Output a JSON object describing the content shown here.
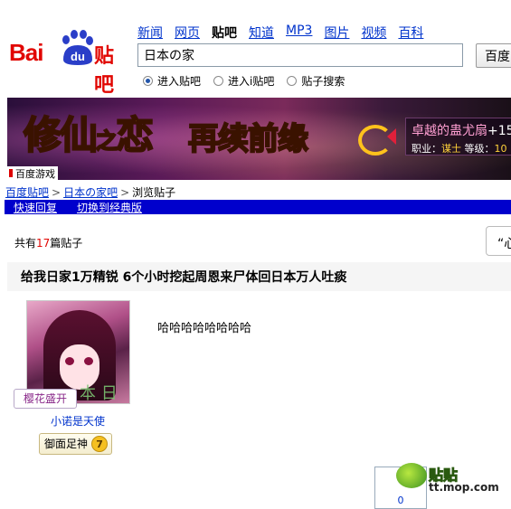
{
  "logo": {
    "bai": "Bai",
    "du": "du",
    "tieba": "贴吧"
  },
  "nav": {
    "items": [
      "新闻",
      "网页",
      "贴吧",
      "知道",
      "MP3",
      "图片",
      "视频",
      "百科"
    ],
    "active_index": 2
  },
  "search": {
    "value": "日本の家",
    "button_label": "百度"
  },
  "radios": {
    "options": [
      "进入贴吧",
      "进入i贴吧",
      "贴子搜索"
    ],
    "selected_index": 0
  },
  "banner": {
    "title_part1": "修仙",
    "title_small": "之",
    "title_part2": "恋",
    "title_part3": "再续前缘",
    "info_line1_prefix": "卓越的蛊尤扇",
    "info_line1_value": "+15",
    "info_line2_label": "职业：",
    "info_line2_value": "谋士",
    "info_line2_label2": "等级：",
    "info_line2_value2": "10",
    "footer": "百度游戏"
  },
  "breadcrumb": {
    "items": [
      "百度贴吧",
      "日本の家吧",
      "浏览贴子"
    ],
    "separator": ">"
  },
  "toolbar": {
    "quick_reply": "快速回复",
    "switch_classic": "切换到经典版"
  },
  "post_count": {
    "prefix": "共有",
    "count": "17",
    "suffix": "篇贴子",
    "reply_box_label": "“心"
  },
  "thread": {
    "title": "给我日家1万精锐 6个小时挖起周恩来尸体回日本万人吐痰"
  },
  "post": {
    "avatar_watermark": "本 日",
    "tag": "樱花盛开",
    "username": "小诺是天使",
    "badge_label": "御面足神",
    "badge_level": "7",
    "content": "哈哈哈哈哈哈哈哈"
  },
  "footer": {
    "vote_count": "0",
    "watermark_text": "贴贴",
    "watermark_url": "tt.mop.com"
  }
}
